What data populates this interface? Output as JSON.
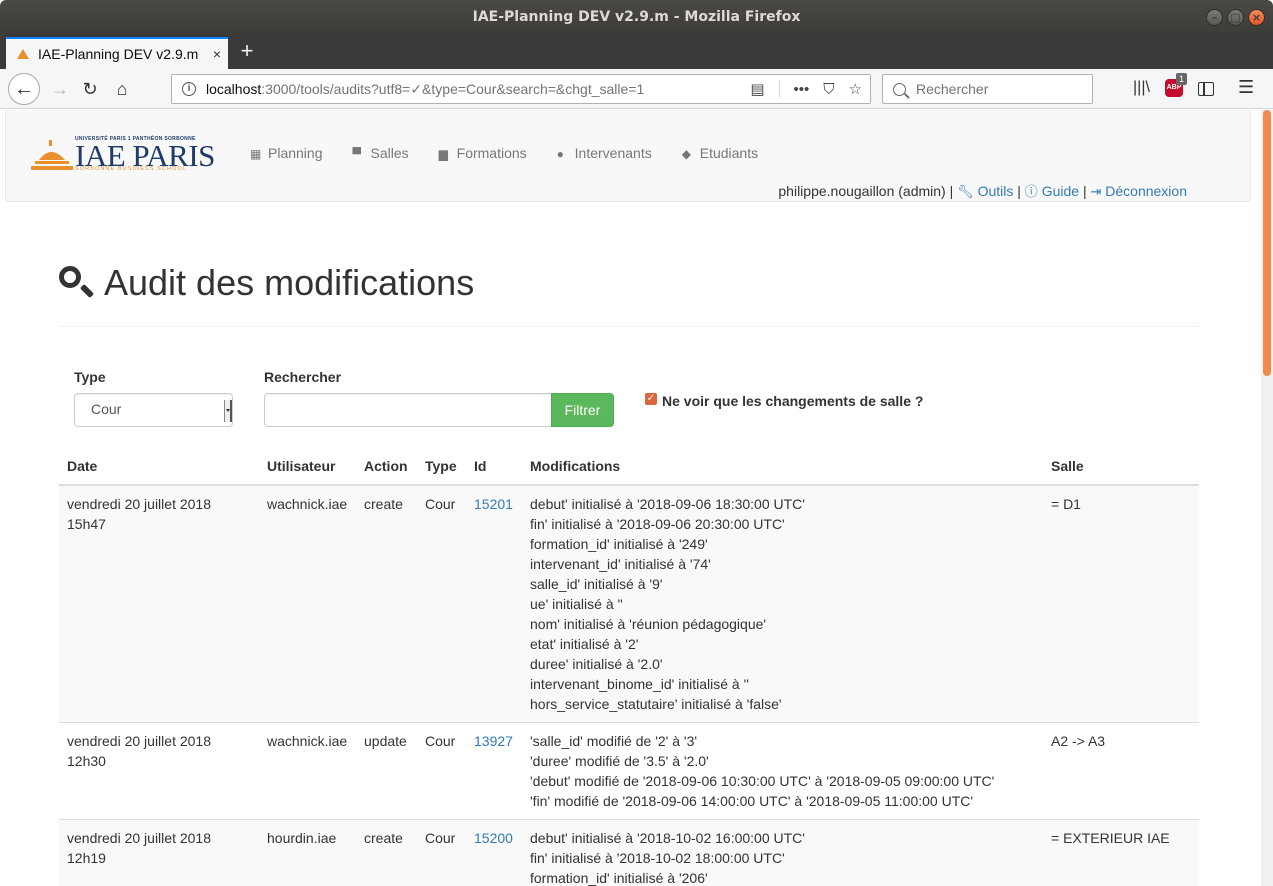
{
  "window": {
    "title": "IAE-Planning DEV v2.9.m - Mozilla Firefox"
  },
  "tab": {
    "title": "IAE-Planning DEV v2.9.m",
    "close": "×",
    "new": "+"
  },
  "browser": {
    "url_host": "localhost",
    "url_rest": ":3000/tools/audits?utf8=✓&type=Cour&search=&chgt_salle=1",
    "search_placeholder": "Rechercher",
    "abp_badge": "1"
  },
  "logo": {
    "top": "UNIVERSITÉ PARIS 1 PANTHÉON SORBONNE",
    "name": "IAE PARIS",
    "sub": "SORBONNE BUSINESS SCHOOL"
  },
  "menu": [
    "Planning",
    "Salles",
    "Formations",
    "Intervenants",
    "Etudiants"
  ],
  "userbar": {
    "user": "philippe.nougaillon (admin)",
    "outils": "Outils",
    "guide": "Guide",
    "logout": "Déconnexion",
    "sep": "|"
  },
  "page": {
    "title": "Audit des modifications"
  },
  "filters": {
    "type_label": "Type",
    "type_value": "Cour",
    "search_label": "Rechercher",
    "search_value": "",
    "filter_button": "Filtrer",
    "checkbox_label": "Ne voir que les changements de salle ?",
    "checkbox_checked": true
  },
  "table": {
    "headers": [
      "Date",
      "Utilisateur",
      "Action",
      "Type",
      "Id",
      "Modifications",
      "Salle"
    ],
    "rows": [
      {
        "date1": "vendredi 20 juillet 2018",
        "date2": "15h47",
        "user": "wachnick.iae",
        "action": "create",
        "type": "Cour",
        "id": "15201",
        "mods": [
          "debut' initialisé à '2018-09-06 18:30:00 UTC'",
          "fin' initialisé à '2018-09-06 20:30:00 UTC'",
          "formation_id' initialisé à '249'",
          "intervenant_id' initialisé à '74'",
          "salle_id' initialisé à '9'",
          "ue' initialisé à ''",
          "nom' initialisé à 'réunion pédagogique'",
          "etat' initialisé à '2'",
          "duree' initialisé à '2.0'",
          "intervenant_binome_id' initialisé à ''",
          "hors_service_statutaire' initialisé à 'false'"
        ],
        "salle": "= D1"
      },
      {
        "date1": "vendredi 20 juillet 2018",
        "date2": "12h30",
        "user": "wachnick.iae",
        "action": "update",
        "type": "Cour",
        "id": "13927",
        "mods": [
          "'salle_id' modifié de '2' à '3'",
          "'duree' modifié de '3.5' à '2.0'",
          "'debut' modifié de '2018-09-06 10:30:00 UTC' à '2018-09-05 09:00:00 UTC'",
          "'fin' modifié de '2018-09-06 14:00:00 UTC' à '2018-09-05 11:00:00 UTC'"
        ],
        "salle": "A2 -> A3"
      },
      {
        "date1": "vendredi 20 juillet 2018",
        "date2": "12h19",
        "user": "hourdin.iae",
        "action": "create",
        "type": "Cour",
        "id": "15200",
        "mods": [
          "debut' initialisé à '2018-10-02 16:00:00 UTC'",
          "fin' initialisé à '2018-10-02 18:00:00 UTC'",
          "formation_id' initialisé à '206'"
        ],
        "salle": "= EXTERIEUR IAE"
      }
    ]
  }
}
